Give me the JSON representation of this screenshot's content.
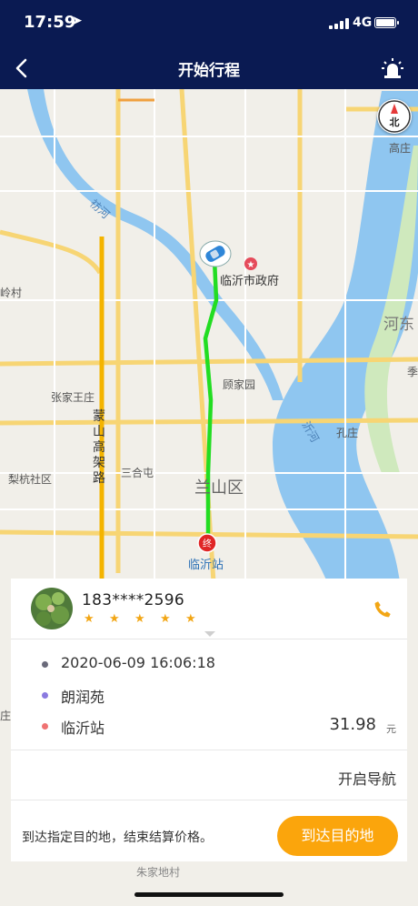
{
  "status_bar": {
    "time": "17:59",
    "network": "4G"
  },
  "header": {
    "title": "开始行程"
  },
  "map": {
    "labels": {
      "river_yi_north": "祊河",
      "city_gov": "临沂市政府",
      "gaozhuang": "高庄",
      "hedong": "河东",
      "ling_village": "岭村",
      "gujia": "顾家园",
      "zhangjia": "张家王庄",
      "highway": "蒙山高架路",
      "yi_river": "沂河",
      "kongzhuang": "孔庄",
      "lihang": "梨杭社区",
      "sanhe": "三合屯",
      "lanshan": "兰山区",
      "station": "临沂站",
      "end_marker": "终",
      "compass_north": "北",
      "bottom_partial": "朱家地村",
      "edge_ji": "季",
      "edge_zhuang": "庄"
    }
  },
  "driver": {
    "phone": "183****2596",
    "stars": [
      "★",
      "★",
      "★",
      "★",
      "★"
    ],
    "rating": 5
  },
  "trip": {
    "time": "2020-06-09 16:06:18",
    "pickup": "朗润苑",
    "destination": "临沂站",
    "price": "31.98",
    "price_unit": "元"
  },
  "actions": {
    "start_nav": "开启导航",
    "hint": "到达指定目的地，结束结算价格。",
    "arrive_button": "到达目的地"
  },
  "colors": {
    "nav_bg": "#0a1a52",
    "route": "#22dd22",
    "accent": "#fba50c",
    "river": "#8fc6f0",
    "star": "#f2a615"
  }
}
